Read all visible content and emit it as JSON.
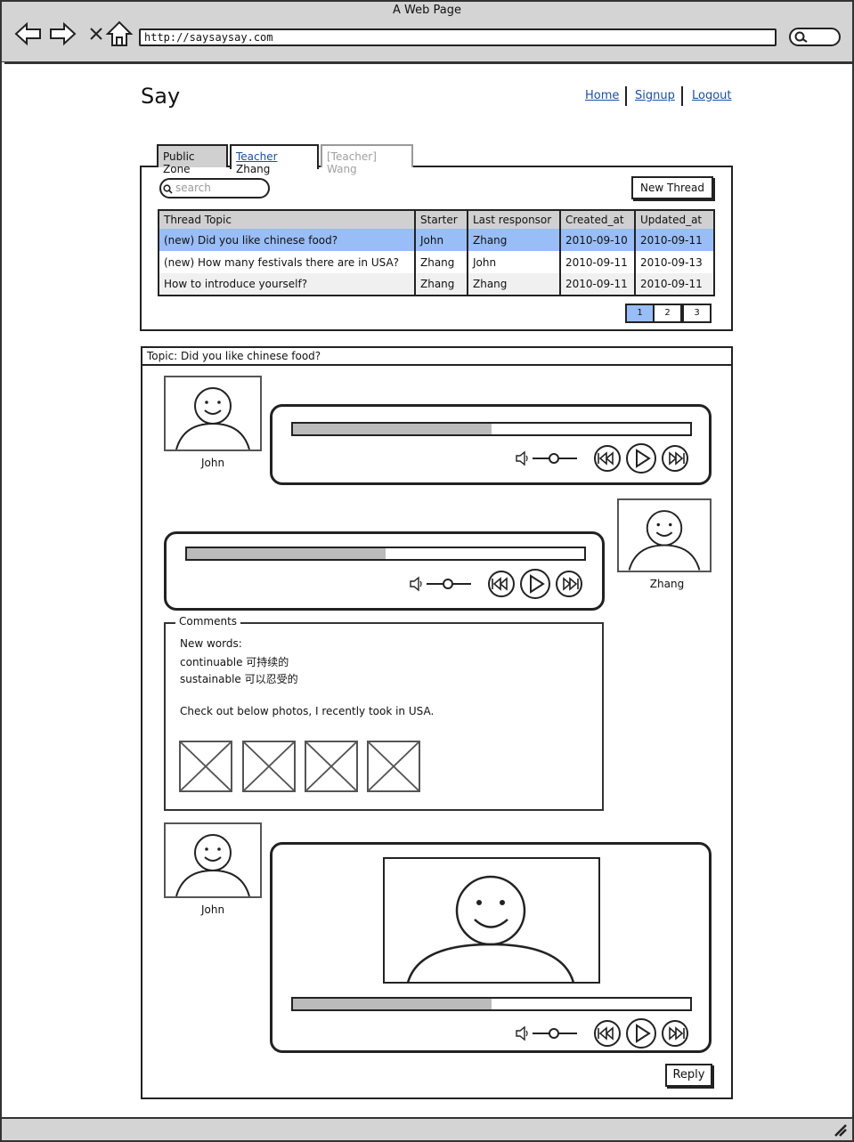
{
  "window": {
    "title": "A Web Page",
    "url": "http://saysaysay.com"
  },
  "header": {
    "logo": "Say",
    "links": [
      "Home",
      "Signup",
      "Logout"
    ]
  },
  "tabs": [
    {
      "label": "Public Zone"
    },
    {
      "prefix": "Teacher",
      "label": "Zhang"
    },
    {
      "label": "[Teacher] Wang"
    }
  ],
  "search": {
    "placeholder": "search"
  },
  "new_thread_label": "New Thread",
  "table": {
    "columns": [
      "Thread Topic",
      "Starter",
      "Last responsor",
      "Created_at",
      "Updated_at"
    ],
    "rows": [
      {
        "tag": "(new)",
        "topic": "Did you like chinese food?",
        "starter": "John",
        "last": "Zhang",
        "created": "2010-09-10",
        "updated": "2010-09-11"
      },
      {
        "tag": "(new)",
        "topic": "How many festivals there are in USA?",
        "starter": "Zhang",
        "last": "John",
        "created": "2010-09-11",
        "updated": "2010-09-13"
      },
      {
        "tag": "",
        "topic": "How to introduce yourself?",
        "starter": "Zhang",
        "last": "Zhang",
        "created": "2010-09-11",
        "updated": "2010-09-11"
      }
    ]
  },
  "pagination": [
    "1",
    "2",
    "3"
  ],
  "topic": {
    "title": "Topic: Did you like chinese food?"
  },
  "posts": [
    {
      "author": "John",
      "progress": 0.5
    },
    {
      "author": "Zhang",
      "progress": 0.5
    },
    {
      "author": "John",
      "progress": 0.5
    }
  ],
  "comments": {
    "legend": "Comments",
    "heading": "New words:",
    "lines": [
      "continuable 可持续的",
      "sustainable 可以忍受的"
    ],
    "note": "Check out below photos, I recently took in USA."
  },
  "reply_label": "Reply",
  "icons": [
    "back-icon",
    "forward-icon",
    "close-icon",
    "home-icon",
    "search-icon",
    "volume-icon",
    "rewind-icon",
    "play-icon",
    "fast-forward-icon",
    "image-placeholder-icon",
    "resize-grip-icon"
  ]
}
